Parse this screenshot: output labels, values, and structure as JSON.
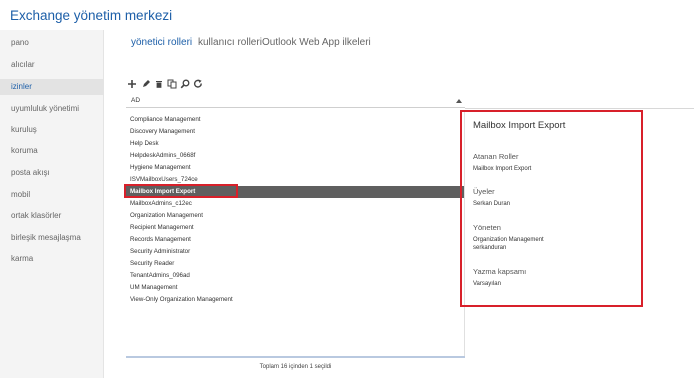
{
  "app": {
    "title": "Exchange yönetim merkezi"
  },
  "sidebar": {
    "items": [
      {
        "label": "pano",
        "active": false
      },
      {
        "label": "alıcılar",
        "active": false
      },
      {
        "label": "izinler",
        "active": true
      },
      {
        "label": "uyumluluk yönetimi",
        "active": false
      },
      {
        "label": "kuruluş",
        "active": false
      },
      {
        "label": "koruma",
        "active": false
      },
      {
        "label": "posta akışı",
        "active": false
      },
      {
        "label": "mobil",
        "active": false
      },
      {
        "label": "ortak klasörler",
        "active": false
      },
      {
        "label": "birleşik mesajlaşma",
        "active": false
      },
      {
        "label": "karma",
        "active": false
      }
    ]
  },
  "tabs": [
    {
      "label": "yönetici rolleri",
      "active": true
    },
    {
      "label": "kullanıcı rolleri",
      "active": false
    },
    {
      "label": "Outlook Web App ilkeleri",
      "active": false
    }
  ],
  "toolbar": {
    "buttons": [
      "add-icon",
      "edit-icon",
      "delete-icon",
      "copy-icon",
      "search-icon",
      "refresh-icon"
    ]
  },
  "list": {
    "column_header": "AD",
    "rows": [
      "Compliance Management",
      "Discovery Management",
      "Help Desk",
      "HelpdeskAdmins_0668f",
      "Hygiene Management",
      "ISVMailboxUsers_724ce",
      "Mailbox Import Export",
      "MailboxAdmins_c12ec",
      "Organization Management",
      "Recipient Management",
      "Records Management",
      "Security Administrator",
      "Security Reader",
      "TenantAdmins_096ad",
      "UM Management",
      "View-Only Organization Management"
    ],
    "selected_index": 6
  },
  "status": "Toplam 16 içinden 1 seçildi",
  "details": {
    "title": "Mailbox Import Export",
    "assigned_roles_label": "Atanan Roller",
    "assigned_roles_value": "Mailbox Import Export",
    "members_label": "Üyeler",
    "members_value": "Serkan Duran",
    "managers_label": "Yöneten",
    "managers_value_1": "Organization Management",
    "managers_value_2": "serkanduran",
    "scope_label": "Yazma kapsamı",
    "scope_value": "Varsayılan"
  },
  "colors": {
    "accent": "#1d5fa8",
    "highlight": "#d8202a",
    "selected_row": "#5f5f5f"
  }
}
